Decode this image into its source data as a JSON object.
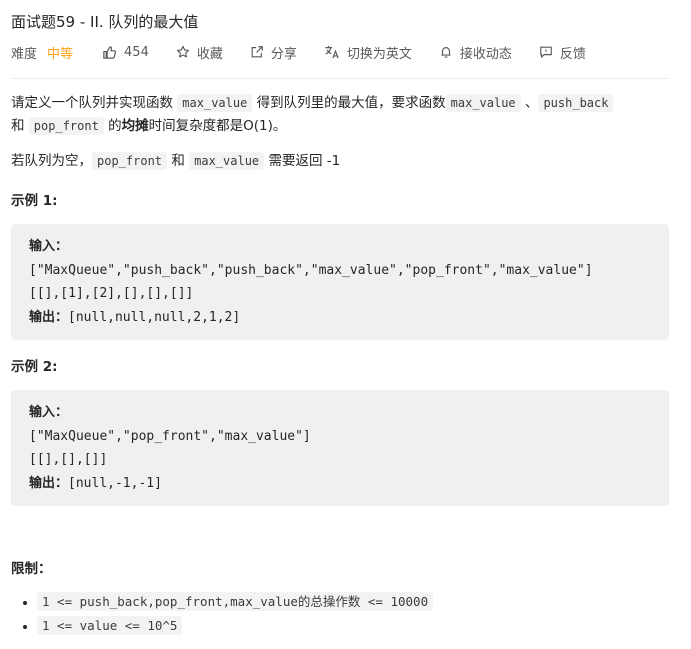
{
  "title": "面试题59 - II. 队列的最大值",
  "meta": {
    "difficulty_label": "难度",
    "difficulty": "中等",
    "likes": "454",
    "favorite": "收藏",
    "share": "分享",
    "switch_lang": "切换为英文",
    "notify": "接收动态",
    "feedback": "反馈"
  },
  "colors": {
    "difficulty": "#ffa116",
    "code_bg": "#f3f3f3",
    "block_bg": "#f0f0f0"
  },
  "description": {
    "p1": [
      "请定义一个队列并实现函数 ",
      "max_value",
      " 得到队列里的最大值，要求函数",
      "max_value",
      " 、",
      "push_back",
      "和 ",
      "pop_front",
      " 的",
      "均摊",
      "时间复杂度都是O(1)。"
    ],
    "p2": [
      "若队列为空，",
      "pop_front",
      " 和 ",
      "max_value",
      " 需要返回 -1"
    ]
  },
  "examples": [
    {
      "heading": "示例 1:",
      "input_label": "输入：",
      "line1": "[\"MaxQueue\",\"push_back\",\"push_back\",\"max_value\",\"pop_front\",\"max_value\"]",
      "line2": "[[],[1],[2],[],[],[]]",
      "output_label": "输出：",
      "output": "[null,null,null,2,1,2]"
    },
    {
      "heading": "示例 2:",
      "input_label": "输入：",
      "line1": "[\"MaxQueue\",\"pop_front\",\"max_value\"]",
      "line2": "[[],[],[]]",
      "output_label": "输出：",
      "output": "[null,-1,-1]"
    }
  ],
  "limits": {
    "heading": "限制：",
    "items": [
      "1 <= push_back,pop_front,max_value的总操作数 <= 10000",
      "1 <= value <= 10^5"
    ]
  }
}
